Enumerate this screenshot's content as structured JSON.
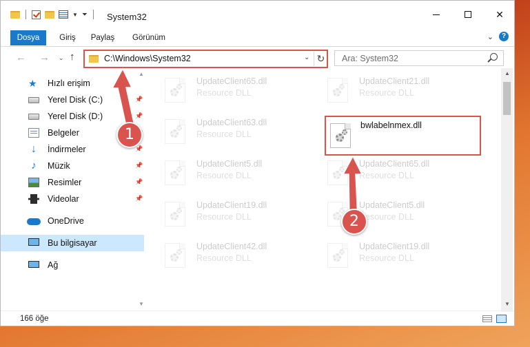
{
  "window": {
    "title": "System32",
    "controls": {
      "minimize": "minimize",
      "maximize": "maximize",
      "close": "✕"
    }
  },
  "ribbon": {
    "tabs": [
      "Dosya",
      "Giriş",
      "Paylaş",
      "Görünüm"
    ],
    "help": "?"
  },
  "address": {
    "path": "C:\\Windows\\System32",
    "search_placeholder": "Ara: System32"
  },
  "sidebar": {
    "items": [
      {
        "label": "Hızlı erişim",
        "icon": "star-icon",
        "pinned": false
      },
      {
        "label": "Yerel Disk (C:)",
        "icon": "disk-icon",
        "pinned": true
      },
      {
        "label": "Yerel Disk (D:)",
        "icon": "disk-icon",
        "pinned": true
      },
      {
        "label": "Belgeler",
        "icon": "documents-icon",
        "pinned": true
      },
      {
        "label": "İndirmeler",
        "icon": "download-icon",
        "pinned": true
      },
      {
        "label": "Müzik",
        "icon": "music-icon",
        "pinned": true
      },
      {
        "label": "Resimler",
        "icon": "pictures-icon",
        "pinned": true
      },
      {
        "label": "Videolar",
        "icon": "videos-icon",
        "pinned": true
      },
      {
        "label": "OneDrive",
        "icon": "cloud-icon",
        "pinned": false
      },
      {
        "label": "Bu bilgisayar",
        "icon": "computer-icon",
        "pinned": false,
        "selected": true
      },
      {
        "label": "Ağ",
        "icon": "network-icon",
        "pinned": false
      }
    ]
  },
  "files": {
    "left": [
      {
        "name": "UpdateClient65.dll",
        "type": "Resource DLL"
      },
      {
        "name": "UpdateClient63.dll",
        "type": "Resource DLL"
      },
      {
        "name": "UpdateClient5.dll",
        "type": "Resource DLL"
      },
      {
        "name": "UpdateClient19.dll",
        "type": "Resource DLL"
      },
      {
        "name": "UpdateClient42.dll",
        "type": "Resource DLL"
      }
    ],
    "right": [
      {
        "name": "UpdateClient21.dll",
        "type": "Resource DLL"
      },
      {
        "name": "bwlabelnmex.dll",
        "type": ""
      },
      {
        "name": "UpdateClient65.dll",
        "type": "Resource DLL"
      },
      {
        "name": "UpdateClient5.dll",
        "type": "Resource DLL"
      },
      {
        "name": "UpdateClient19.dll",
        "type": "Resource DLL"
      }
    ]
  },
  "status": {
    "count": "166 öğe"
  },
  "callouts": {
    "one": "1",
    "two": "2"
  },
  "colors": {
    "accent": "#1979ca",
    "highlight": "#d9534f",
    "selected": "#cce8ff"
  }
}
